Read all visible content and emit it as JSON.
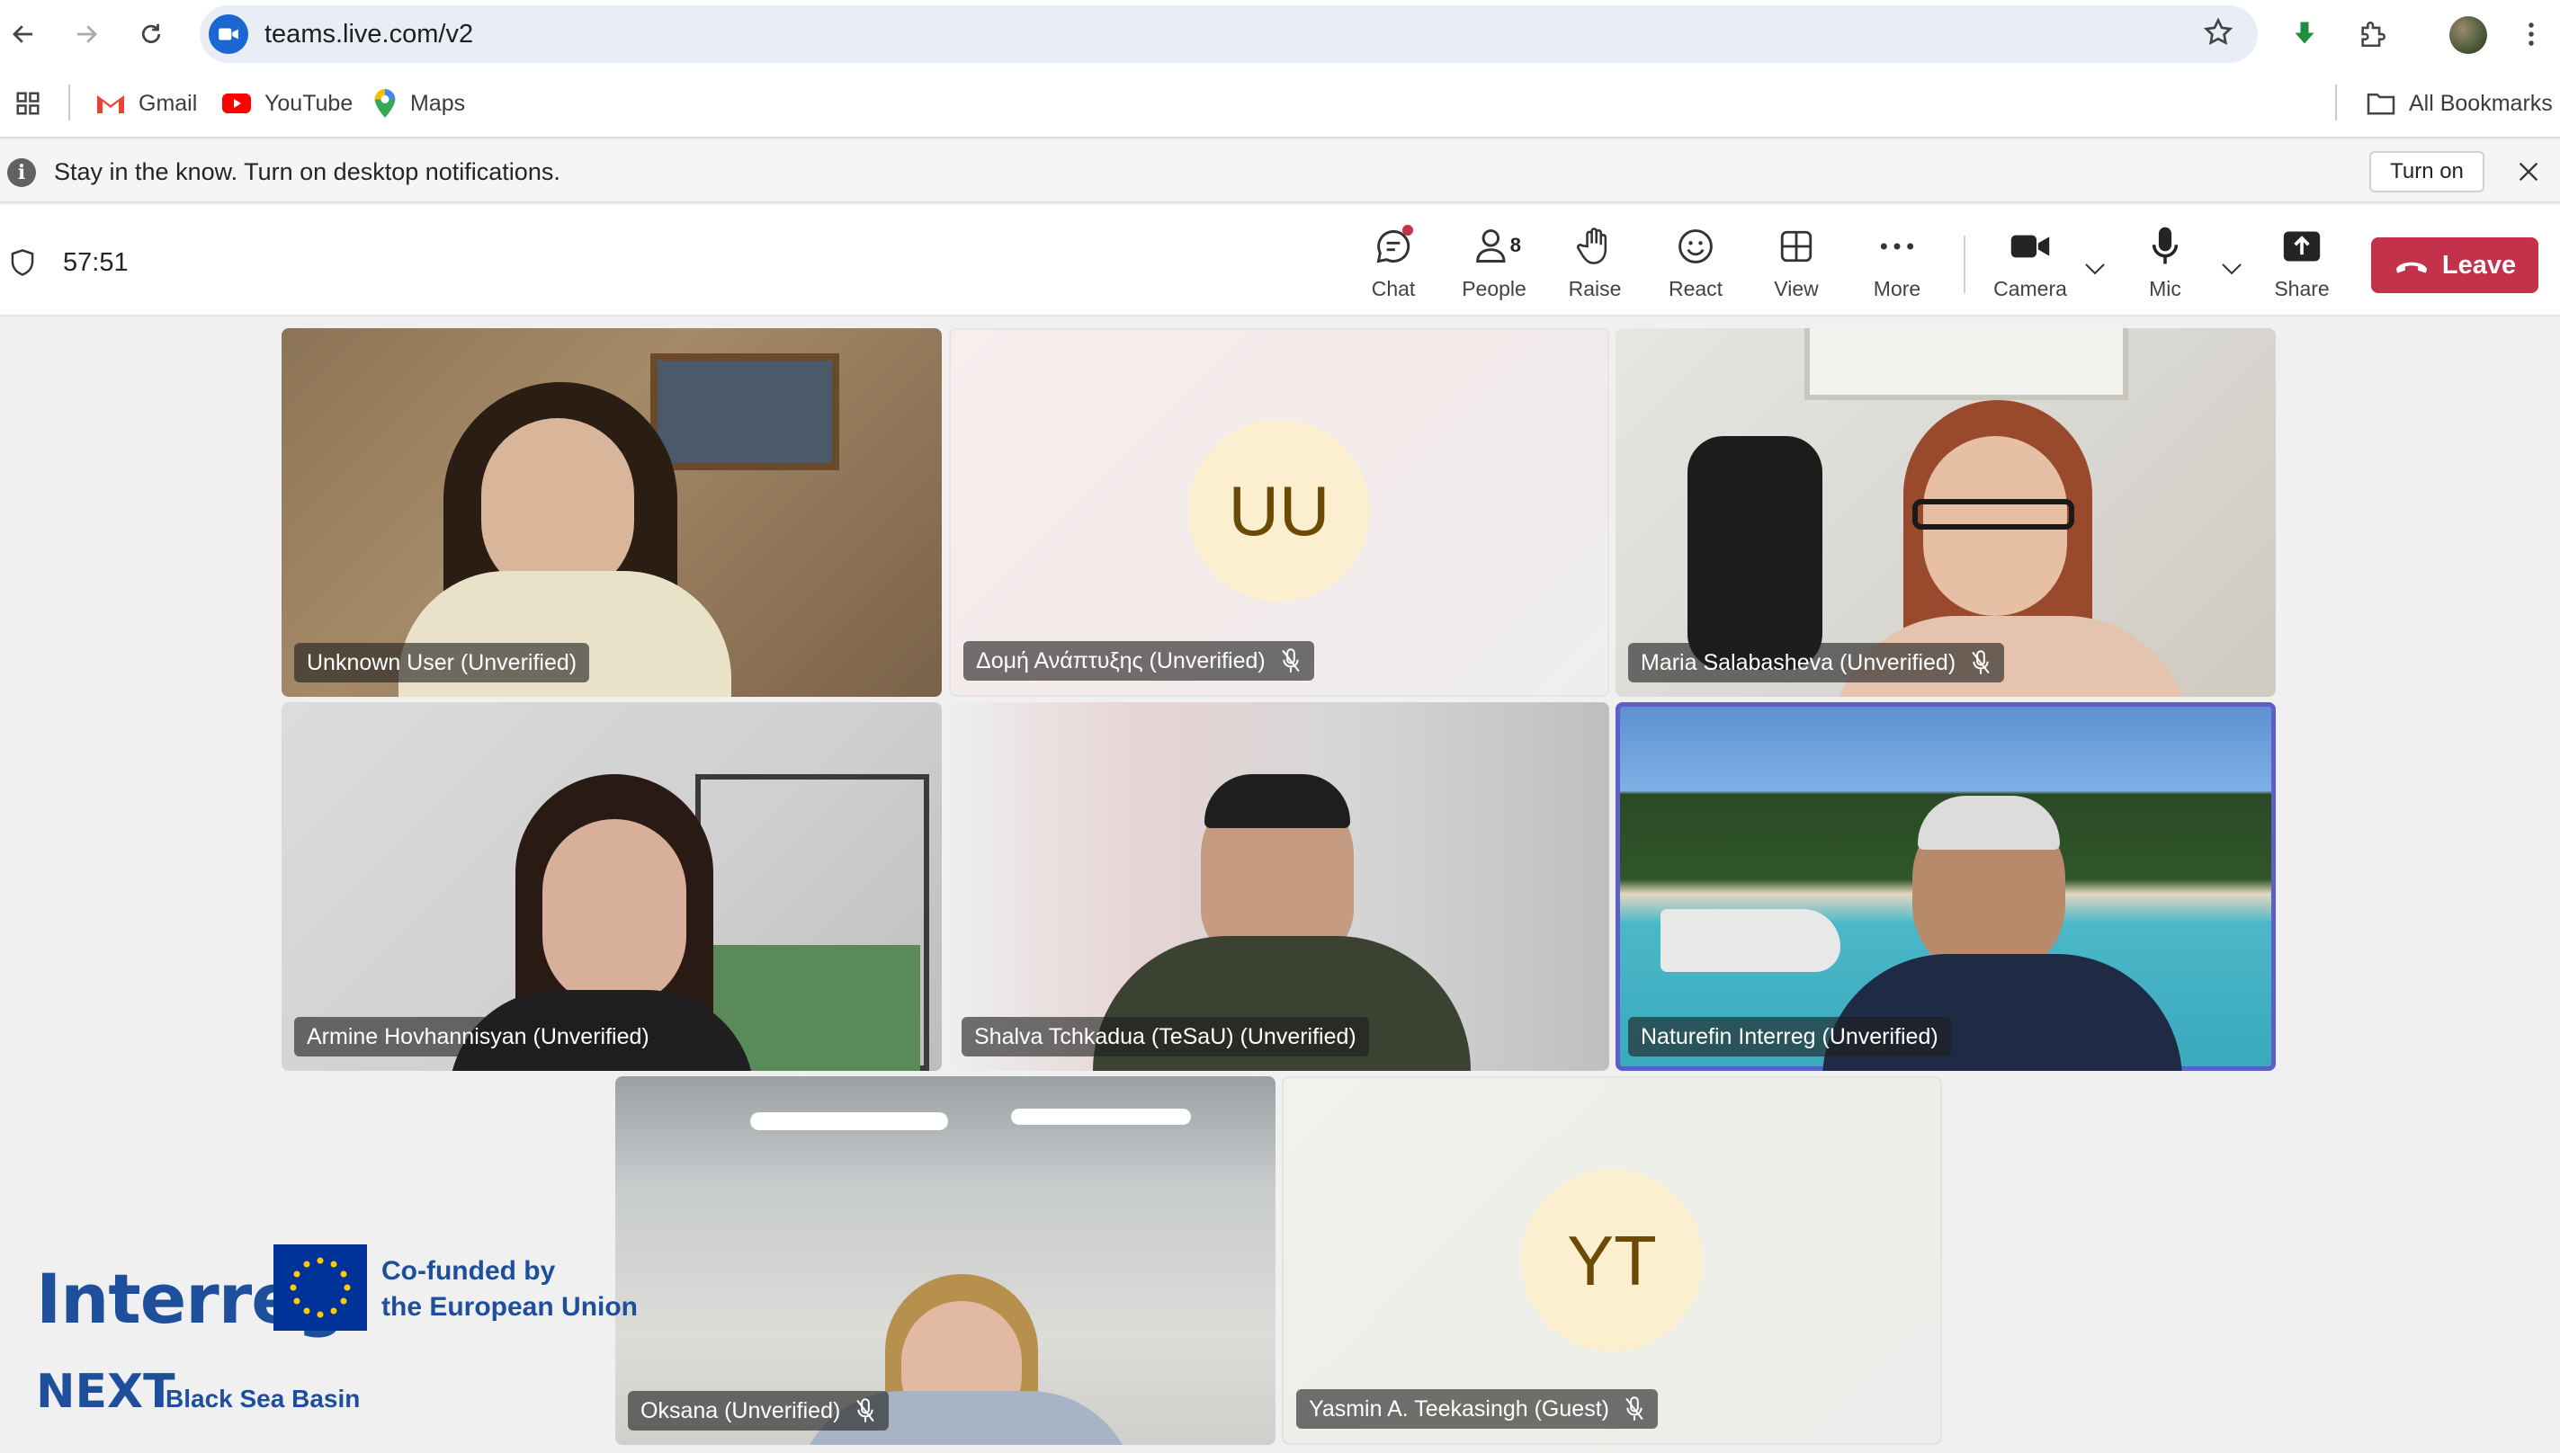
{
  "browser": {
    "url": "teams.live.com/v2",
    "bookmarks": [
      {
        "label": "Gmail"
      },
      {
        "label": "YouTube"
      },
      {
        "label": "Maps"
      }
    ],
    "all_bookmarks_label": "All Bookmarks"
  },
  "notification": {
    "text": "Stay in the know. Turn on desktop notifications.",
    "button_label": "Turn on"
  },
  "meeting": {
    "timer": "57:51",
    "people_count": "8",
    "tools": {
      "chat": "Chat",
      "people": "People",
      "raise": "Raise",
      "react": "React",
      "view": "View",
      "more": "More",
      "camera": "Camera",
      "mic": "Mic",
      "share": "Share"
    },
    "leave_label": "Leave"
  },
  "participants": [
    {
      "name": "Unknown User (Unverified)",
      "muted": false,
      "video": true
    },
    {
      "name": "Δομή Ανάπτυξης (Unverified)",
      "muted": true,
      "video": false,
      "initials": "UU"
    },
    {
      "name": "Maria Salabasheva (Unverified)",
      "muted": true,
      "video": true
    },
    {
      "name": "Armine Hovhannisyan (Unverified)",
      "muted": false,
      "video": true
    },
    {
      "name": "Shalva Tchkadua (TeSaU) (Unverified)",
      "muted": false,
      "video": true
    },
    {
      "name": "Naturefin Interreg (Unverified)",
      "muted": false,
      "video": true,
      "active_speaker": true
    },
    {
      "name": "Oksana (Unverified)",
      "muted": true,
      "video": true
    },
    {
      "name": "Yasmin A. Teekasingh (Guest)",
      "muted": true,
      "video": false,
      "initials": "YT"
    }
  ],
  "logo": {
    "interreg": "Interreg",
    "eu_line1": "Co-funded by",
    "eu_line2": "the European Union",
    "next": "NEXT",
    "black_sea": "Black Sea Basin"
  },
  "colors": {
    "leave": "#c4314b",
    "active_speaker_border": "#5b5fc7",
    "avatar_bg": "#fbefcf",
    "avatar_text": "#6b4a06",
    "logo_blue": "#1e4f9c"
  }
}
